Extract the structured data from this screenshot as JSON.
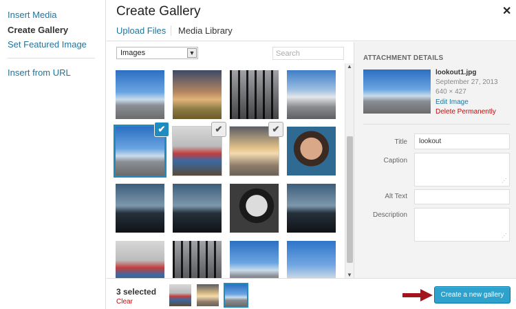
{
  "menu": {
    "items": [
      {
        "label": "Insert Media"
      },
      {
        "label": "Create Gallery"
      },
      {
        "label": "Set Featured Image"
      },
      {
        "label": "Insert from URL"
      }
    ]
  },
  "header": {
    "title": "Create Gallery",
    "close_glyph": "✕",
    "tabs": [
      {
        "label": "Upload Files"
      },
      {
        "label": "Media Library"
      }
    ]
  },
  "toolbar": {
    "filter_value": "Images",
    "search_placeholder": "Search"
  },
  "grid": {
    "items": [
      {
        "image": "lookout-mountain",
        "selected": false
      },
      {
        "image": "balancing-person",
        "selected": false
      },
      {
        "image": "train-station",
        "selected": false
      },
      {
        "image": "mountain-landscape",
        "selected": false
      },
      {
        "image": "lookout-mountain",
        "selected": true,
        "current": true
      },
      {
        "image": "paris-street",
        "selected": true
      },
      {
        "image": "beach-sunset",
        "selected": true
      },
      {
        "image": "woman-portrait",
        "selected": false
      },
      {
        "image": "violinist-silhouette",
        "selected": false
      },
      {
        "image": "violinist-silhouette",
        "selected": false
      },
      {
        "image": "man-portrait-bw",
        "selected": false
      },
      {
        "image": "violinist-silhouette",
        "selected": false
      },
      {
        "image": "paris-street",
        "selected": false
      },
      {
        "image": "train-station",
        "selected": false
      },
      {
        "image": "lookout-mountain",
        "selected": false
      },
      {
        "image": "jumping-people",
        "selected": false
      }
    ],
    "check_glyph": "✔"
  },
  "details": {
    "heading": "ATTACHMENT DETAILS",
    "filename": "lookout1.jpg",
    "date": "September 27, 2013",
    "dimensions": "640 × 427",
    "edit_label": "Edit Image",
    "delete_label": "Delete Permanently",
    "fields": {
      "title_label": "Title",
      "title_value": "lookout",
      "caption_label": "Caption",
      "caption_value": "",
      "alt_label": "Alt Text",
      "alt_value": "",
      "description_label": "Description",
      "description_value": ""
    }
  },
  "selection": {
    "count_label": "3 selected",
    "clear_label": "Clear",
    "thumbs": [
      "paris-street",
      "beach-sunset",
      "lookout-mountain"
    ]
  },
  "actions": {
    "create_label": "Create a new gallery"
  },
  "colors": {
    "link": "#21759b",
    "accent": "#1e8cbe",
    "delete": "#bc0b0b",
    "primary_button": "#2ea2cc",
    "arrow": "#a3141c"
  }
}
